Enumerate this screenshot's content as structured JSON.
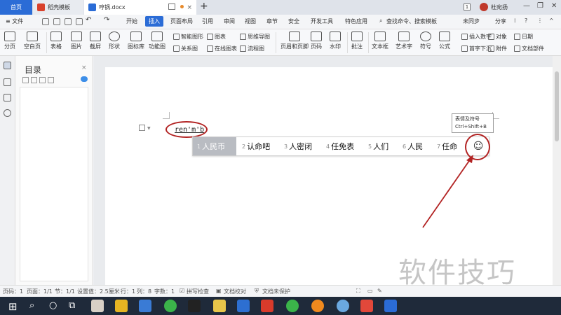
{
  "tabs": {
    "home": "首页",
    "template": "稻壳模板",
    "document": "哼锅.docx",
    "new_tab": "+"
  },
  "titlebar": {
    "badge": "1",
    "user": "杜宛扬"
  },
  "menu": {
    "file": "≡ 文件",
    "items": [
      "开始",
      "插入",
      "页面布局",
      "引用",
      "审阅",
      "视图",
      "章节",
      "安全",
      "开发工具",
      "特色应用"
    ],
    "search": "查找命令、搜索模板",
    "sync": "未同步",
    "share": "分享"
  },
  "ribbon": {
    "big": [
      "分页",
      "空白页",
      "表格",
      "图片",
      "截屏",
      "形状",
      "图标库",
      "功能图",
      "页眉和页脚",
      "页码",
      "水印",
      "批注",
      "文本框",
      "艺术字",
      "符号",
      "公式"
    ],
    "small_left": [
      "智能图形",
      "关系图",
      "图表",
      "在线图表",
      "思维导图",
      "流程图"
    ],
    "small_right": [
      "插入数字",
      "对象",
      "日期",
      "首字下沉",
      "附件",
      "文档部件"
    ]
  },
  "outline": {
    "title": "目录",
    "close": "×"
  },
  "document": {
    "pinyin": "ren'm'b"
  },
  "ime": {
    "candidates": [
      {
        "num": "1",
        "word": "人民币"
      },
      {
        "num": "2",
        "word": "认命吧"
      },
      {
        "num": "3",
        "word": "人密闭"
      },
      {
        "num": "4",
        "word": "任免表"
      },
      {
        "num": "5",
        "word": "人们"
      },
      {
        "num": "6",
        "word": "人民"
      },
      {
        "num": "7",
        "word": "任命"
      }
    ],
    "emoji_glyph": "☺"
  },
  "tooltip": {
    "line1": "表情及符号",
    "line2": "Ctrl+Shift+B"
  },
  "watermark": "软件技巧",
  "status": {
    "page_code": "页码：1",
    "pages": "页面：1/1",
    "section": "节：1/1",
    "position": "设置值：2.5厘米",
    "row": "行：1",
    "col": "列：8",
    "words": "字数：1",
    "spell": "拼写检查",
    "proof": "文档校对",
    "protect": "文档未保护"
  },
  "colors": {
    "accent": "#2b6cd6",
    "annotation": "#b22222",
    "taskbar": "#1f2a3a"
  }
}
